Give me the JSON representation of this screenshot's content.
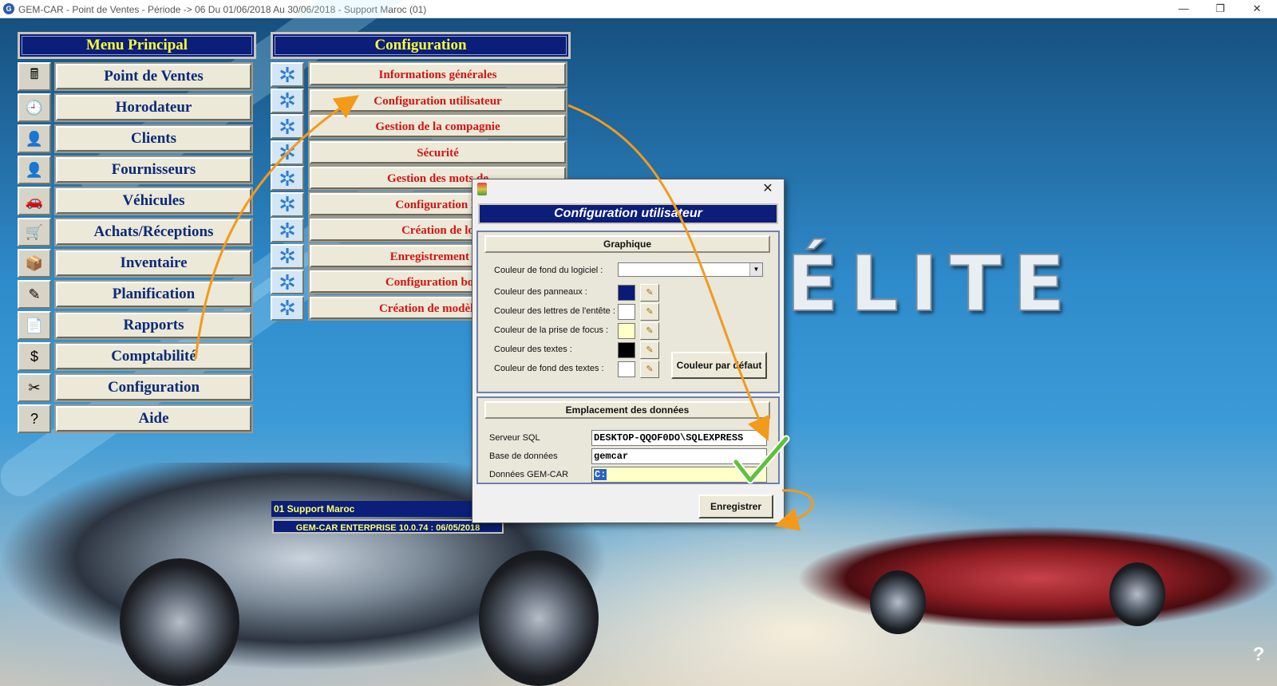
{
  "window": {
    "title": "GEM-CAR - Point de Ventes - Période -> 06 Du 01/06/2018 Au 30/06/2018 - Support Maroc (01)",
    "app_icon": "G",
    "controls": {
      "minimize": "—",
      "restore": "❐",
      "close": "✕"
    }
  },
  "background": {
    "logo_text": "ÉLITE"
  },
  "main_menu": {
    "title": "Menu Principal",
    "items": [
      {
        "label": "Point de Ventes",
        "icon": "cash-register-icon",
        "glyph": "🖩"
      },
      {
        "label": "Horodateur",
        "icon": "clock-icon",
        "glyph": "🕘"
      },
      {
        "label": "Clients",
        "icon": "customer-icon",
        "glyph": "👤"
      },
      {
        "label": "Fournisseurs",
        "icon": "supplier-icon",
        "glyph": "👤"
      },
      {
        "label": "Véhicules",
        "icon": "car-icon",
        "glyph": "🚗"
      },
      {
        "label": "Achats/Réceptions",
        "icon": "cart-icon",
        "glyph": "🛒"
      },
      {
        "label": "Inventaire",
        "icon": "inventory-icon",
        "glyph": "📦"
      },
      {
        "label": "Planification",
        "icon": "pen-icon",
        "glyph": "✎"
      },
      {
        "label": "Rapports",
        "icon": "report-icon",
        "glyph": "📄"
      },
      {
        "label": "Comptabilité",
        "icon": "dollar-icon",
        "glyph": "$"
      },
      {
        "label": "Configuration",
        "icon": "tools-icon",
        "glyph": "✂"
      },
      {
        "label": "Aide",
        "icon": "help-icon",
        "glyph": "?"
      }
    ]
  },
  "config_menu": {
    "title": "Configuration",
    "gear_glyph": "✲",
    "items": [
      {
        "label": "Informations générales"
      },
      {
        "label": "Configuration utilisateur"
      },
      {
        "label": "Gestion de la compagnie"
      },
      {
        "label": "Sécurité"
      },
      {
        "label": "Gestion des mots de"
      },
      {
        "label": "Configuration lo"
      },
      {
        "label": "Création de lo"
      },
      {
        "label": "Enregistrement du"
      },
      {
        "label": "Configuration bouto"
      },
      {
        "label": "Création de modèles d'"
      }
    ]
  },
  "status": {
    "company": "01 Support Maroc",
    "version": "GEM-CAR ENTERPRISE 10.0.74 : 06/05/2018"
  },
  "dialog": {
    "close": "✕",
    "title": "Configuration utilisateur",
    "graphics_group": {
      "title": "Graphique",
      "background_label": "Couleur de fond du logiciel  :",
      "background_value": "",
      "colors": [
        {
          "label": "Couleur des panneaux :",
          "color": "#0a1a78"
        },
        {
          "label": "Couleur des lettres de l'entête :",
          "color": "#ffffff"
        },
        {
          "label": "Couleur de la prise de focus :",
          "color": "#ffffc8"
        },
        {
          "label": "Couleur des textes :",
          "color": "#000000"
        },
        {
          "label": "Couleur de fond des textes :",
          "color": "#ffffff"
        }
      ],
      "default_button": "Couleur par défaut"
    },
    "data_group": {
      "title": "Emplacement des données",
      "sql_server_label": "Serveur SQL",
      "sql_server_value": "DESKTOP-QQOF0DO\\SQLEXPRESS",
      "database_label": "Base de données",
      "database_value": "gemcar",
      "data_label": "Données GEM-CAR",
      "data_value": "C:"
    },
    "save_button": "Enregistrer"
  },
  "colors": {
    "panel_navy": "#0b1e7a",
    "menu_title_yellow": "#ffff33",
    "menu_text_blue": "#0b2a7a",
    "config_text_red": "#d31414",
    "arrow_orange": "#f39a1b",
    "check_green": "#5cc23a"
  }
}
